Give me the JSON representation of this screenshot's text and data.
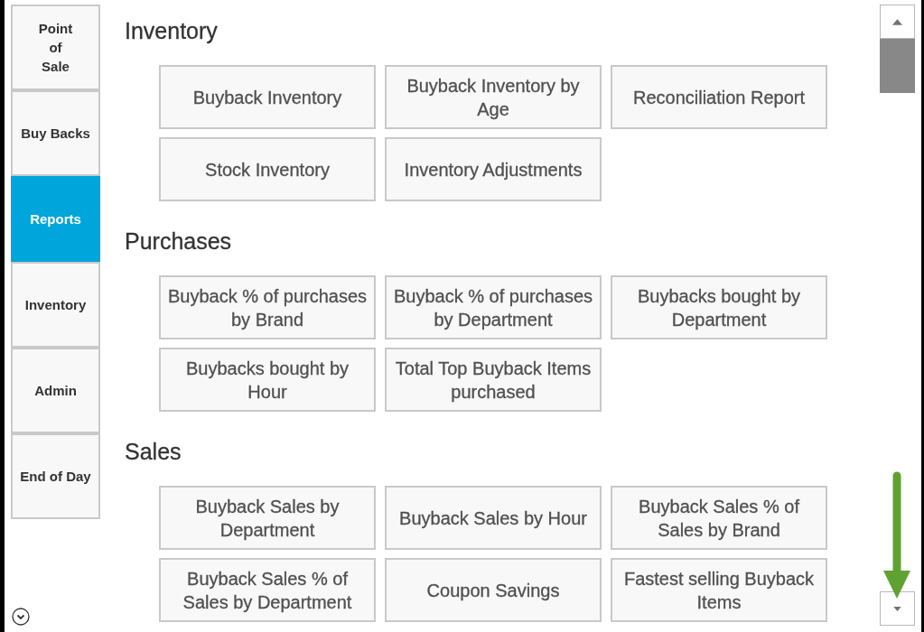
{
  "sidebar": {
    "tabs": [
      {
        "label": "Point\nof\nSale",
        "selected": false
      },
      {
        "label": "Buy Backs",
        "selected": false
      },
      {
        "label": "Reports",
        "selected": true
      },
      {
        "label": "Inventory",
        "selected": false
      },
      {
        "label": "Admin",
        "selected": false
      },
      {
        "label": "End of Day",
        "selected": false
      }
    ]
  },
  "sections": [
    {
      "title": "Inventory",
      "reports": [
        "Buyback Inventory",
        "Buyback Inventory by Age",
        "Reconciliation Report",
        "Stock Inventory",
        "Inventory Adjustments"
      ]
    },
    {
      "title": "Purchases",
      "reports": [
        "Buyback % of purchases by Brand",
        "Buyback % of purchases by Department",
        "Buybacks bought by Department",
        "Buybacks bought by Hour",
        "Total Top Buyback Items purchased"
      ]
    },
    {
      "title": "Sales",
      "reports": [
        "Buyback Sales by Department",
        "Buyback Sales by Hour",
        "Buyback Sales % of Sales by Brand",
        "Buyback Sales % of Sales by Department",
        "Coupon Savings",
        "Fastest selling Buyback Items"
      ]
    }
  ]
}
